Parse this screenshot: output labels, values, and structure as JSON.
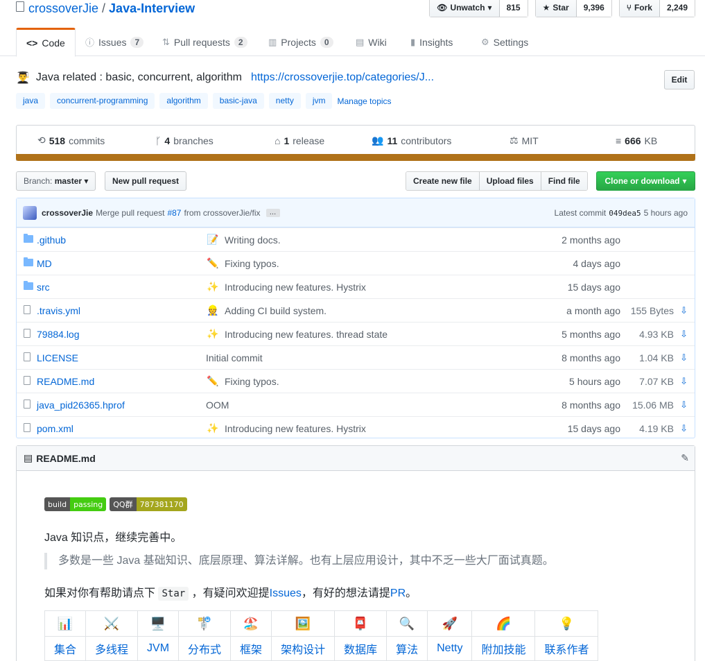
{
  "repo": {
    "owner": "crossoverJie",
    "separator": "/",
    "name": "Java-Interview"
  },
  "actions": {
    "watch_label": "Unwatch",
    "watch_count": "815",
    "star_label": "Star",
    "star_count": "9,396",
    "fork_label": "Fork",
    "fork_count": "2,249"
  },
  "tabs": [
    {
      "label": "Code",
      "icon": "code-icon"
    },
    {
      "label": "Issues",
      "count": "7",
      "icon": "issue-icon"
    },
    {
      "label": "Pull requests",
      "count": "2",
      "icon": "pr-icon"
    },
    {
      "label": "Projects",
      "count": "0",
      "icon": "project-icon"
    },
    {
      "label": "Wiki",
      "icon": "book-icon"
    },
    {
      "label": "Insights",
      "icon": "graph-icon"
    },
    {
      "label": "Settings",
      "icon": "gear-icon"
    }
  ],
  "description": {
    "text": "Java related : basic, concurrent, algorithm",
    "url": "https://crossoverjie.top/categories/J...",
    "emoji": "👨‍🎓"
  },
  "edit_label": "Edit",
  "topics": [
    "java",
    "concurrent-programming",
    "algorithm",
    "basic-java",
    "netty",
    "jvm"
  ],
  "manage_topics": "Manage topics",
  "summary": {
    "commits_num": "518",
    "commits_label": "commits",
    "branches_num": "4",
    "branches_label": "branches",
    "release_num": "1",
    "release_label": "release",
    "contributors_num": "11",
    "contributors_label": "contributors",
    "license": "MIT",
    "size_num": "666",
    "size_unit": "KB",
    "language_color": "#b07219"
  },
  "filenav": {
    "branch_prefix": "Branch:",
    "branch": "master",
    "new_pr": "New pull request",
    "create_file": "Create new file",
    "upload": "Upload files",
    "find": "Find file",
    "clone": "Clone or download"
  },
  "commit_tease": {
    "author": "crossoverJie",
    "prefix": "Merge pull request",
    "pr": "#87",
    "suffix": "from crossoverJie/fix",
    "ellipsis": "…",
    "latest_label": "Latest commit",
    "sha": "049dea5",
    "age": "5 hours ago"
  },
  "files": [
    {
      "type": "dir",
      "name": ".github",
      "emoji": "📝",
      "message": "Writing docs.",
      "age": "2 months ago",
      "size": ""
    },
    {
      "type": "dir",
      "name": "MD",
      "emoji": "✏️",
      "message": "Fixing typos.",
      "age": "4 days ago",
      "size": ""
    },
    {
      "type": "dir",
      "name": "src",
      "emoji": "✨",
      "message": "Introducing new features. Hystrix",
      "age": "15 days ago",
      "size": ""
    },
    {
      "type": "file",
      "name": ".travis.yml",
      "emoji": "👷",
      "message": "Adding CI build system.",
      "age": "a month ago",
      "size": "155 Bytes"
    },
    {
      "type": "file",
      "name": "79884.log",
      "emoji": "✨",
      "message": "Introducing new features. thread state",
      "age": "5 months ago",
      "size": "4.93 KB"
    },
    {
      "type": "file",
      "name": "LICENSE",
      "emoji": "",
      "message": "Initial commit",
      "age": "8 months ago",
      "size": "1.04 KB"
    },
    {
      "type": "file",
      "name": "README.md",
      "emoji": "✏️",
      "message": "Fixing typos.",
      "age": "5 hours ago",
      "size": "7.07 KB"
    },
    {
      "type": "file",
      "name": "java_pid26365.hprof",
      "emoji": "",
      "message": "OOM",
      "age": "8 months ago",
      "size": "15.06 MB"
    },
    {
      "type": "file",
      "name": "pom.xml",
      "emoji": "✨",
      "message": "Introducing new features. Hystrix",
      "age": "15 days ago",
      "size": "4.19 KB"
    }
  ],
  "readme": {
    "title": "README.md",
    "badge1": {
      "left": "build",
      "right": "passing"
    },
    "badge2": {
      "left": "QQ群",
      "right": "787381170"
    },
    "intro": "Java 知识点，继续完善中。",
    "quote": "多数是一些 Java 基础知识、底层原理、算法详解。也有上层应用设计，其中不乏一些大厂面试真题。",
    "help_before": "如果对你有帮助请点下",
    "help_code": "Star",
    "help_mid": "，有疑问欢迎提",
    "help_issues": "Issues",
    "help_mid2": "，有好的想法请提",
    "help_pr": "PR",
    "help_end": "。",
    "table_icons": [
      "📊",
      "⚔️",
      "🖥️",
      "🚏",
      "🏖️",
      "🖼️",
      "📮",
      "🔍",
      "🚀",
      "🌈",
      "💡"
    ],
    "table_labels": [
      "集合",
      "多线程",
      "JVM",
      "分布式",
      "框架",
      "架构设计",
      "数据库",
      "算法",
      "Netty",
      "附加技能",
      "联系作者"
    ]
  }
}
